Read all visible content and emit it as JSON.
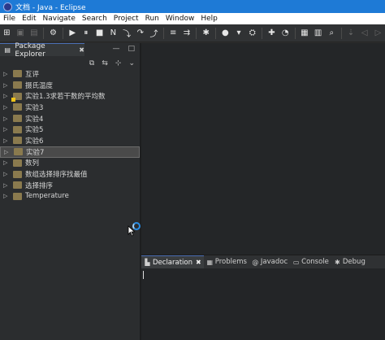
{
  "window": {
    "title": "文档 - Java - Eclipse"
  },
  "menu": [
    "File",
    "Edit",
    "Navigate",
    "Search",
    "Project",
    "Run",
    "Window",
    "Help"
  ],
  "toolbar": {
    "icons": [
      "new-icon",
      "save-icon",
      "save-all-icon",
      "settings-icon",
      "resume-icon",
      "suspend-icon",
      "terminate-icon",
      "disconnect-icon",
      "step-into-icon",
      "step-over-icon",
      "step-return-icon",
      "drop-to-frame-icon",
      "use-step-filters-icon",
      "debug-icon",
      "run-icon",
      "run-menu-icon",
      "external-tools-icon",
      "new-java-project-icon",
      "new-package-icon",
      "new-class-icon",
      "open-type-icon",
      "search-icon",
      "next-annotation-icon",
      "back-icon",
      "forward-icon"
    ]
  },
  "package_explorer": {
    "title": "Package Explorer",
    "items": [
      {
        "label": "互评",
        "warn": false
      },
      {
        "label": "摄氏温度",
        "warn": false
      },
      {
        "label": "实验1.3求若干数的平均数",
        "warn": true
      },
      {
        "label": "实验3",
        "warn": false
      },
      {
        "label": "实验4",
        "warn": false
      },
      {
        "label": "实验5",
        "warn": false
      },
      {
        "label": "实验6",
        "warn": false
      },
      {
        "label": "实验7",
        "warn": false,
        "selected": true
      },
      {
        "label": "数列",
        "warn": false
      },
      {
        "label": "数组选择排序找最值",
        "warn": false
      },
      {
        "label": "选择排序",
        "warn": false
      },
      {
        "label": "Temperature",
        "warn": false
      }
    ]
  },
  "bottom_tabs": [
    {
      "label": "Declaration",
      "icon": "declaration-icon",
      "active": true
    },
    {
      "label": "Problems",
      "icon": "problems-icon",
      "active": false
    },
    {
      "label": "Javadoc",
      "icon": "javadoc-icon",
      "active": false
    },
    {
      "label": "Console",
      "icon": "console-icon",
      "active": false
    },
    {
      "label": "Debug",
      "icon": "debug-icon",
      "active": false
    }
  ],
  "colors": {
    "titlebar": "#1e7ad6",
    "background": "#2b2b2b",
    "selection": "#4a4a4a",
    "accent": "#4b6fb5"
  }
}
